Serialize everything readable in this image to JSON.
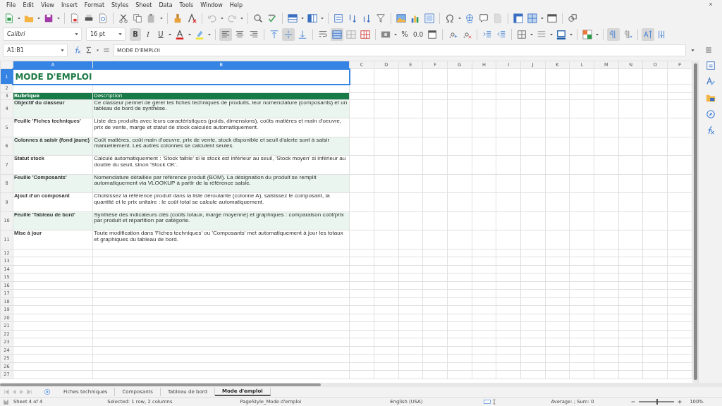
{
  "menu": [
    "File",
    "Edit",
    "View",
    "Insert",
    "Format",
    "Styles",
    "Sheet",
    "Data",
    "Tools",
    "Window",
    "Help"
  ],
  "format_toolbar": {
    "font_name": "Calibri",
    "font_size": "16 pt",
    "bold": "B",
    "italic": "I",
    "underline": "U",
    "percent": "%",
    "standard": "0.0"
  },
  "formula_bar": {
    "name_box": "A1:B1",
    "content": "MODE D'EMPLOI"
  },
  "sheet": {
    "columns": [
      {
        "label": "A",
        "selected": true
      },
      {
        "label": "B",
        "selected": true
      },
      {
        "label": "C",
        "selected": false
      },
      {
        "label": "D",
        "selected": false
      },
      {
        "label": "E",
        "selected": false
      },
      {
        "label": "F",
        "selected": false
      },
      {
        "label": "G",
        "selected": false
      },
      {
        "label": "H",
        "selected": false
      },
      {
        "label": "I",
        "selected": false
      },
      {
        "label": "J",
        "selected": false
      },
      {
        "label": "K",
        "selected": false
      },
      {
        "label": "L",
        "selected": false
      },
      {
        "label": "M",
        "selected": false
      },
      {
        "label": "N",
        "selected": false
      },
      {
        "label": "O",
        "selected": false
      },
      {
        "label": "P",
        "selected": false
      }
    ],
    "rows": [
      {
        "number": "1",
        "selected": true,
        "kind": "title",
        "cells": [
          "MODE D'EMPLOI"
        ]
      },
      {
        "number": "2",
        "selected": false,
        "kind": "empty"
      },
      {
        "number": "3",
        "selected": false,
        "kind": "header",
        "cells": [
          "Rubrique",
          "Description"
        ]
      },
      {
        "number": "4",
        "selected": false,
        "kind": "band",
        "cells": [
          "Objectif du classeur",
          "Ce classeur permet de gérer les fiches techniques de produits, leur nomenclature (composants) et un tableau de bord de synthèse."
        ]
      },
      {
        "number": "5",
        "selected": false,
        "kind": "plain",
        "cells": [
          "Feuille 'Fiches techniques'",
          "Liste des produits avec leurs caractéristiques (poids, dimensions), coûts matières et main d'oeuvre, prix de vente, marge et statut de stock calculés automatiquement."
        ]
      },
      {
        "number": "6",
        "selected": false,
        "kind": "band",
        "cells": [
          "Colonnes à saisir (fond jaune)",
          "Coût matières, coût main d'oeuvre, prix de vente, stock disponible et seuil d'alerte sont à saisir manuellement. Les autres colonnes se calculent seules."
        ]
      },
      {
        "number": "7",
        "selected": false,
        "kind": "plain",
        "cells": [
          "Statut stock",
          "Calculé automatiquement : 'Stock faible' si le stock est inférieur au seuil, 'Stock moyen' si inférieur au double du seuil, sinon 'Stock OK'."
        ]
      },
      {
        "number": "8",
        "selected": false,
        "kind": "band",
        "cells": [
          "Feuille 'Composants'",
          "Nomenclature détaillée par référence produit (BOM). La désignation du produit se remplit automatiquement via VLOOKUP à partir de la référence saisie."
        ]
      },
      {
        "number": "9",
        "selected": false,
        "kind": "plain",
        "cells": [
          "Ajout d'un composant",
          "Choisissez la référence produit dans la liste déroulante (colonne A), saisissez le composant, la quantité et le prix unitaire : le coût total se calcule automatiquement."
        ]
      },
      {
        "number": "10",
        "selected": false,
        "kind": "band",
        "cells": [
          "Feuille 'Tableau de bord'",
          "Synthèse des indicateurs clés (coûts totaux, marge moyenne) et graphiques : comparaison coût/prix par produit et répartition par catégorie."
        ]
      },
      {
        "number": "11",
        "selected": false,
        "kind": "plain",
        "cells": [
          "Mise à jour",
          "Toute modification dans 'Fiches techniques' ou 'Composants' met automatiquement à jour les totaux et graphiques du tableau de bord."
        ]
      },
      {
        "number": "12",
        "selected": false,
        "kind": "empty"
      },
      {
        "number": "13",
        "selected": false,
        "kind": "empty"
      },
      {
        "number": "14",
        "selected": false,
        "kind": "empty"
      },
      {
        "number": "15",
        "selected": false,
        "kind": "empty"
      },
      {
        "number": "16",
        "selected": false,
        "kind": "empty"
      },
      {
        "number": "17",
        "selected": false,
        "kind": "empty"
      },
      {
        "number": "18",
        "selected": false,
        "kind": "empty"
      },
      {
        "number": "19",
        "selected": false,
        "kind": "empty"
      },
      {
        "number": "20",
        "selected": false,
        "kind": "empty"
      },
      {
        "number": "21",
        "selected": false,
        "kind": "empty"
      },
      {
        "number": "22",
        "selected": false,
        "kind": "empty"
      },
      {
        "number": "23",
        "selected": false,
        "kind": "empty"
      },
      {
        "number": "24",
        "selected": false,
        "kind": "empty"
      },
      {
        "number": "25",
        "selected": false,
        "kind": "empty"
      },
      {
        "number": "26",
        "selected": false,
        "kind": "empty"
      },
      {
        "number": "27",
        "selected": false,
        "kind": "empty"
      }
    ]
  },
  "sheet_tabs": [
    {
      "label": "Fiches techniques",
      "selected": false
    },
    {
      "label": "Composants",
      "selected": false
    },
    {
      "label": "Tableau de bord",
      "selected": false
    },
    {
      "label": "Mode d'emploi",
      "selected": true
    }
  ],
  "status_bar": {
    "sheet": "Sheet 4 of 4",
    "selection": "Selected: 1 row, 2 columns",
    "page_style": "PageStyle_Mode d'emploi",
    "language": "English (USA)",
    "summary": "Average: ; Sum: 0",
    "zoom": {
      "level": 0.5
    },
    "zoom_reading": "100%"
  }
}
